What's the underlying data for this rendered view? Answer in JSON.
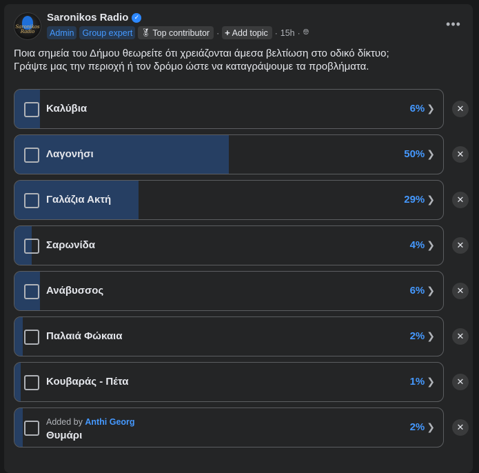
{
  "post": {
    "author": "Saronikos Radio",
    "avatar_text": "Saronikos Radio",
    "verified_icon": "check-icon",
    "badges": [
      "Admin",
      "Group expert"
    ],
    "top_contributor": "Top contributor",
    "add_topic": "Add topic",
    "separator": "·",
    "time": "15h",
    "more_label": "•••",
    "text_line1": "Ποια σημεία του Δήμου θεωρείτε ότι χρειάζονται άμεσα βελτίωση στο οδικό δίκτυο;",
    "text_line2": "Γράψτε μας την περιοχή ή τον δρόμο ώστε να καταγράψουμε τα προβλήματα."
  },
  "poll": {
    "accent_color": "#4599ff",
    "fill_color": "#263f63",
    "options": [
      {
        "label": "Καλύβια",
        "percent": 6,
        "pct_label": "6%"
      },
      {
        "label": "Λαγονήσι",
        "percent": 50,
        "pct_label": "50%"
      },
      {
        "label": "Γαλάζια Ακτή",
        "percent": 29,
        "pct_label": "29%"
      },
      {
        "label": "Σαρωνίδα",
        "percent": 4,
        "pct_label": "4%"
      },
      {
        "label": "Ανάβυσσος",
        "percent": 6,
        "pct_label": "6%"
      },
      {
        "label": "Παλαιά Φώκαια",
        "percent": 2,
        "pct_label": "2%"
      },
      {
        "label": "Κουβαράς - Πέτα",
        "percent": 1,
        "pct_label": "1%"
      },
      {
        "label": "Θυμάρι",
        "percent": 2,
        "pct_label": "2%",
        "added_by_prefix": "Added by",
        "added_by": "Anthi Georg"
      }
    ]
  }
}
